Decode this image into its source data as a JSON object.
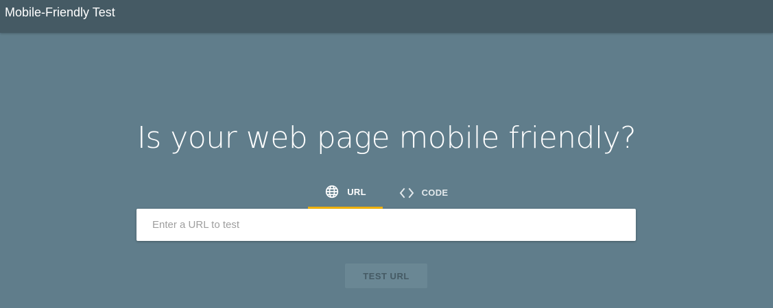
{
  "app": {
    "title": "Mobile-Friendly Test"
  },
  "main": {
    "headline": "Is your web page mobile friendly?",
    "tabs": [
      {
        "label": "URL",
        "icon": "globe-icon",
        "selected": true
      },
      {
        "label": "CODE",
        "icon": "code-icon",
        "selected": false
      }
    ],
    "url_input": {
      "placeholder": "Enter a URL to test",
      "value": ""
    },
    "test_button": {
      "label": "TEST URL",
      "enabled": false
    }
  },
  "colors": {
    "app_bar": "#455a64",
    "background": "#607d8b",
    "tab_indicator": "#f4b400",
    "input_bg": "#ffffff",
    "button_disabled_bg": "#6a8794"
  }
}
